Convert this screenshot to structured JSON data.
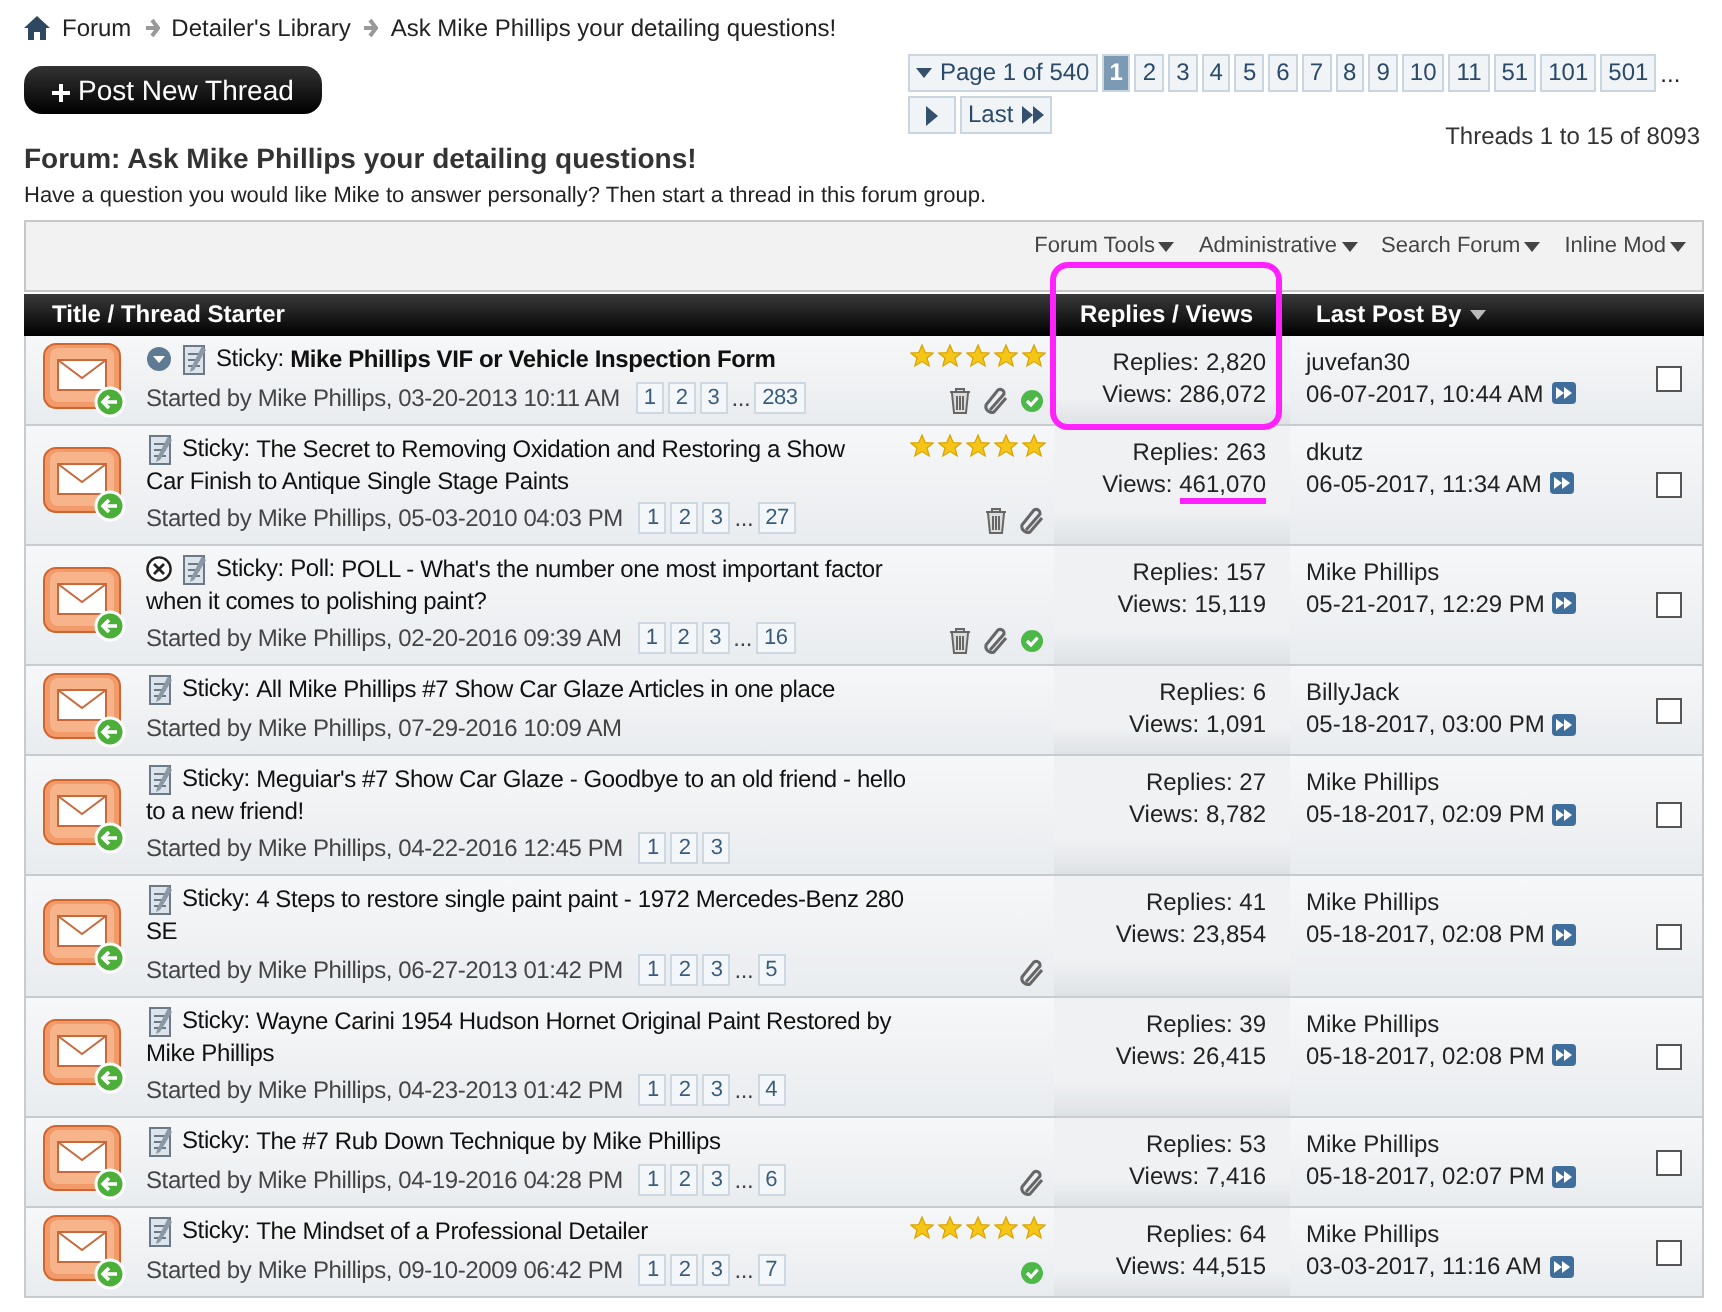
{
  "breadcrumb": {
    "links": [
      "Forum",
      "Detailer's Library"
    ],
    "current": "Ask Mike Phillips your detailing questions!"
  },
  "new_thread_button": "Post New Thread",
  "pagination": {
    "label": "Page 1 of 540",
    "pages": [
      {
        "label": "1",
        "selected": true
      },
      {
        "label": "2",
        "selected": false
      },
      {
        "label": "3",
        "selected": false
      },
      {
        "label": "4",
        "selected": false
      },
      {
        "label": "5",
        "selected": false
      },
      {
        "label": "6",
        "selected": false
      },
      {
        "label": "7",
        "selected": false
      },
      {
        "label": "8",
        "selected": false
      },
      {
        "label": "9",
        "selected": false
      },
      {
        "label": "10",
        "selected": false
      },
      {
        "label": "11",
        "selected": false
      },
      {
        "label": "51",
        "selected": false
      },
      {
        "label": "101",
        "selected": false
      },
      {
        "label": "501",
        "selected": false
      }
    ],
    "ellipsis": "...",
    "last": "Last"
  },
  "thread_count": "Threads 1 to 15 of 8093",
  "forum": {
    "title": "Forum: Ask Mike Phillips your detailing questions!",
    "description": "Have a question you would like Mike to answer personally? Then start a thread in this forum group."
  },
  "toolbar": [
    "Forum Tools",
    "Administrative",
    "Search Forum",
    "Inline Mod"
  ],
  "columns": [
    {
      "label": "Title / Thread Starter",
      "menu": false
    },
    {
      "label": "Replies / Views",
      "menu": false,
      "annotated": true
    },
    {
      "label": "Last Post By",
      "menu": true
    }
  ],
  "threads": [
    {
      "arrow_icon": true,
      "poll": false,
      "prefix": "Sticky:",
      "title": "Mike Phillips VIF or Vehicle Inspection Form",
      "bold": true,
      "starter": "Started by Mike Phillips, 03-20-2013 10:11 AM",
      "pages": [
        "1",
        "2",
        "3"
      ],
      "ellipsis": "...",
      "last_page": "283",
      "stars": 5,
      "trash": true,
      "attachment": true,
      "approved": true,
      "replies_label": "Replies:",
      "replies": "2,820",
      "views_label": "Views:",
      "views": "286,072",
      "views_underlined": false,
      "last_user": "juvefan30",
      "last_date": "06-07-2017, 10:44 AM",
      "checked": false
    },
    {
      "arrow_icon": false,
      "poll": false,
      "prefix": "Sticky:",
      "title": "The Secret to Removing Oxidation and Restoring a Show Car Finish to Antique Single Stage Paints",
      "bold": false,
      "starter": "Started by Mike Phillips, 05-03-2010 04:03 PM",
      "pages": [
        "1",
        "2",
        "3"
      ],
      "ellipsis": "...",
      "last_page": "27",
      "stars": 5,
      "trash": true,
      "attachment": true,
      "approved": false,
      "replies_label": "Replies:",
      "replies": "263",
      "views_label": "Views:",
      "views": "461,070",
      "views_underlined": true,
      "last_user": "dkutz",
      "last_date": "06-05-2017, 11:34 AM",
      "checked": false
    },
    {
      "arrow_icon": false,
      "poll": true,
      "prefix": "Sticky: Poll:",
      "title": "POLL - What's the number one most important factor when it comes to polishing paint?",
      "bold": false,
      "starter": "Started by Mike Phillips, 02-20-2016 09:39 AM",
      "pages": [
        "1",
        "2",
        "3"
      ],
      "ellipsis": "...",
      "last_page": "16",
      "trash": true,
      "attachment": true,
      "approved": true,
      "replies_label": "Replies:",
      "replies": "157",
      "views_label": "Views:",
      "views": "15,119",
      "views_underlined": false,
      "last_user": "Mike Phillips",
      "last_date": "05-21-2017, 12:29 PM",
      "checked": false
    },
    {
      "arrow_icon": false,
      "poll": false,
      "prefix": "Sticky:",
      "title": "All Mike Phillips #7 Show Car Glaze Articles in one place",
      "bold": false,
      "starter": "Started by Mike Phillips, 07-29-2016 10:09 AM",
      "trash": false,
      "attachment": false,
      "approved": false,
      "replies_label": "Replies:",
      "replies": "6",
      "views_label": "Views:",
      "views": "1,091",
      "views_underlined": false,
      "last_user": "BillyJack",
      "last_date": "05-18-2017, 03:00 PM",
      "checked": false
    },
    {
      "arrow_icon": false,
      "poll": false,
      "prefix": "Sticky:",
      "title": "Meguiar's #7 Show Car Glaze - Goodbye to an old friend - hello to a new friend!",
      "bold": false,
      "starter": "Started by Mike Phillips, 04-22-2016 12:45 PM",
      "pages": [
        "1",
        "2",
        "3"
      ],
      "trash": false,
      "attachment": false,
      "approved": false,
      "replies_label": "Replies:",
      "replies": "27",
      "views_label": "Views:",
      "views": "8,782",
      "views_underlined": false,
      "last_user": "Mike Phillips",
      "last_date": "05-18-2017, 02:09 PM",
      "checked": false
    },
    {
      "arrow_icon": false,
      "poll": false,
      "prefix": "Sticky:",
      "title": "4 Steps to restore single paint paint - 1972 Mercedes-Benz 280 SE",
      "bold": false,
      "starter": "Started by Mike Phillips, 06-27-2013 01:42 PM",
      "pages": [
        "1",
        "2",
        "3"
      ],
      "ellipsis": "...",
      "last_page": "5",
      "trash": false,
      "attachment": true,
      "approved": false,
      "replies_label": "Replies:",
      "replies": "41",
      "views_label": "Views:",
      "views": "23,854",
      "views_underlined": false,
      "last_user": "Mike Phillips",
      "last_date": "05-18-2017, 02:08 PM",
      "checked": false
    },
    {
      "arrow_icon": false,
      "poll": false,
      "prefix": "Sticky:",
      "title": "Wayne Carini 1954 Hudson Hornet Original Paint Restored by Mike Phillips",
      "bold": false,
      "starter": "Started by Mike Phillips, 04-23-2013 01:42 PM",
      "pages": [
        "1",
        "2",
        "3"
      ],
      "ellipsis": "...",
      "last_page": "4",
      "trash": false,
      "attachment": false,
      "approved": false,
      "replies_label": "Replies:",
      "replies": "39",
      "views_label": "Views:",
      "views": "26,415",
      "views_underlined": false,
      "last_user": "Mike Phillips",
      "last_date": "05-18-2017, 02:08 PM",
      "checked": false
    },
    {
      "arrow_icon": false,
      "poll": false,
      "prefix": "Sticky:",
      "title": "The #7 Rub Down Technique by Mike Phillips",
      "bold": false,
      "starter": "Started by Mike Phillips, 04-19-2016 04:28 PM",
      "pages": [
        "1",
        "2",
        "3"
      ],
      "ellipsis": "...",
      "last_page": "6",
      "trash": false,
      "attachment": true,
      "approved": false,
      "replies_label": "Replies:",
      "replies": "53",
      "views_label": "Views:",
      "views": "7,416",
      "views_underlined": false,
      "last_user": "Mike Phillips",
      "last_date": "05-18-2017, 02:07 PM",
      "checked": false
    },
    {
      "arrow_icon": false,
      "poll": false,
      "prefix": "Sticky:",
      "title": "The Mindset of a Professional Detailer",
      "bold": false,
      "starter": "Started by Mike Phillips, 09-10-2009 06:42 PM",
      "pages": [
        "1",
        "2",
        "3"
      ],
      "ellipsis": "...",
      "last_page": "7",
      "stars": 5,
      "trash": false,
      "attachment": false,
      "approved": true,
      "replies_label": "Replies:",
      "replies": "64",
      "views_label": "Views:",
      "views": "44,515",
      "views_underlined": false,
      "last_user": "Mike Phillips",
      "last_date": "03-03-2017, 11:16 AM",
      "checked": false
    }
  ]
}
